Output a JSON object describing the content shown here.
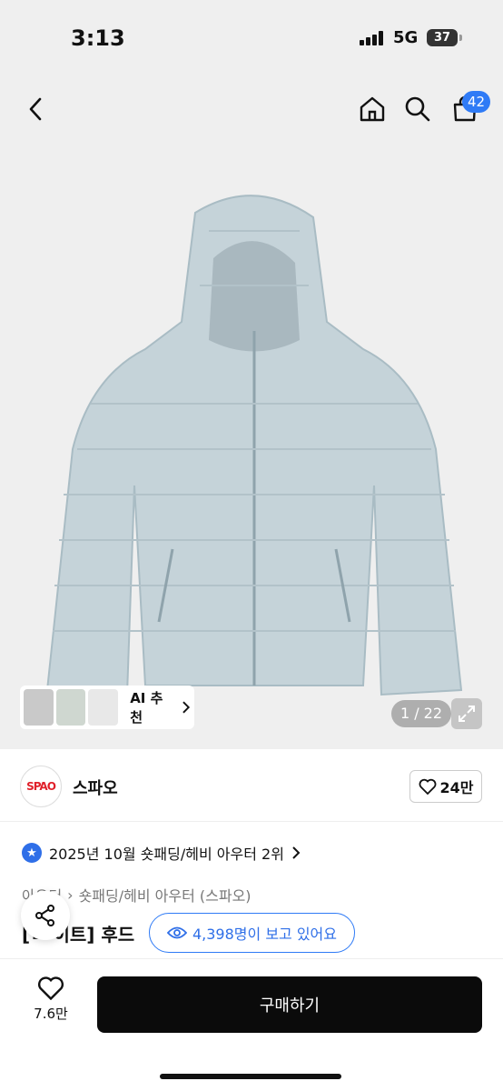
{
  "status": {
    "time": "3:13",
    "network": "5G",
    "battery": "37"
  },
  "header": {
    "cart_count": "42"
  },
  "gallery": {
    "counter": "1 / 22",
    "ai_label": "AI 추천"
  },
  "brand": {
    "logo_text": "SPAO",
    "name": "스파오",
    "likes": "24만"
  },
  "rank": {
    "text": "2025년 10월 숏패딩/헤비 아우터 2위"
  },
  "breadcrumb": {
    "part1": "아우터",
    "part2": "숏패딩/헤비 아우터 (스파오)"
  },
  "product": {
    "title_visible": "[ㄷ 이트] 후드"
  },
  "viewers": {
    "text": "4,398명이 보고 있어요"
  },
  "bottom": {
    "wish_count": "7.6만",
    "buy_label": "구매하기"
  },
  "colors": {
    "accent": "#2f7bf6",
    "buy_bg": "#0b0b0b",
    "jacket": "#c5d3d9"
  },
  "icons": [
    "back-chevron-icon",
    "home-icon",
    "search-icon",
    "cart-icon",
    "expand-icon",
    "chevron-right-icon",
    "heart-icon",
    "star-badge-icon",
    "share-icon",
    "eye-icon"
  ]
}
